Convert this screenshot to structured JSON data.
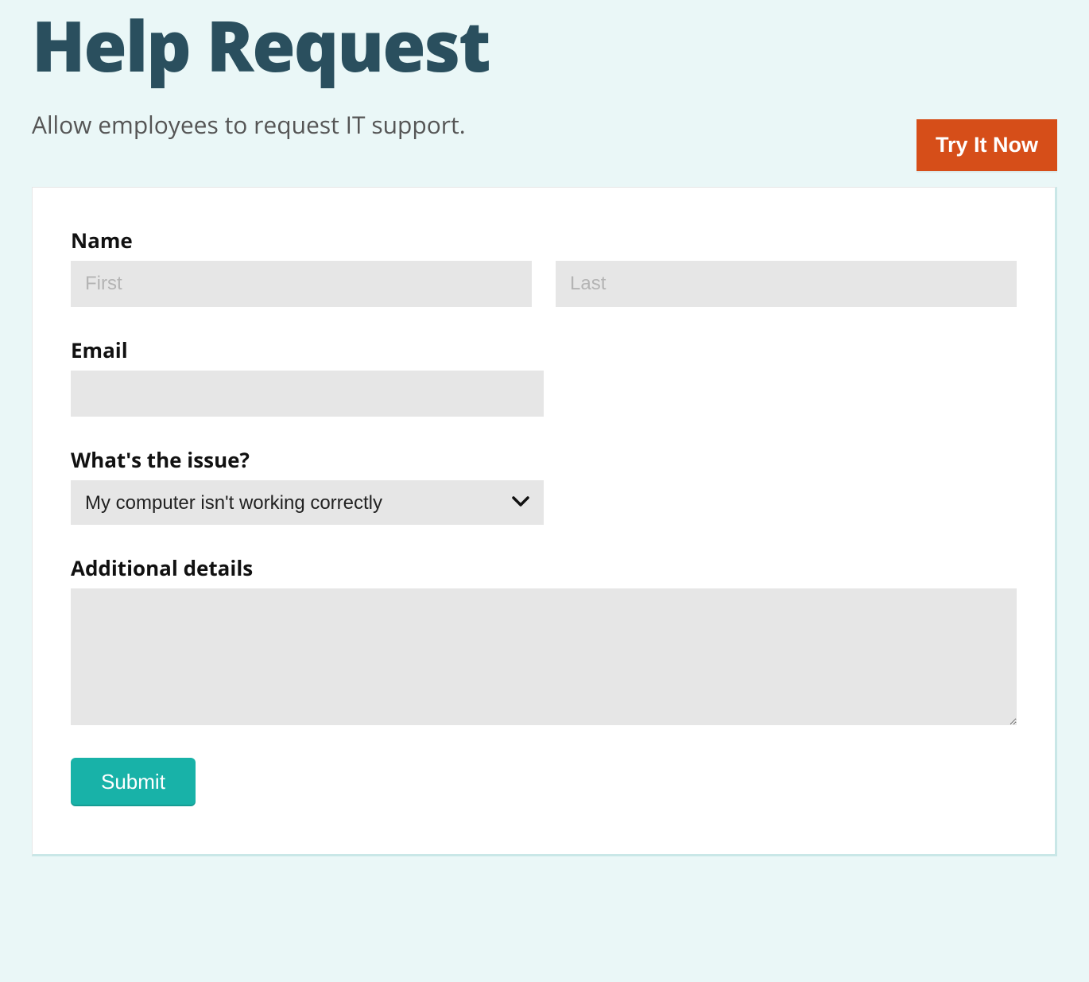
{
  "header": {
    "title": "Help Request",
    "subtitle": "Allow employees to request IT support.",
    "try_button": "Try It Now"
  },
  "form": {
    "name": {
      "label": "Name",
      "first_placeholder": "First",
      "last_placeholder": "Last",
      "first_value": "",
      "last_value": ""
    },
    "email": {
      "label": "Email",
      "value": ""
    },
    "issue": {
      "label": "What's the issue?",
      "selected": "My computer isn't working correctly"
    },
    "details": {
      "label": "Additional details",
      "value": ""
    },
    "submit_label": "Submit"
  }
}
